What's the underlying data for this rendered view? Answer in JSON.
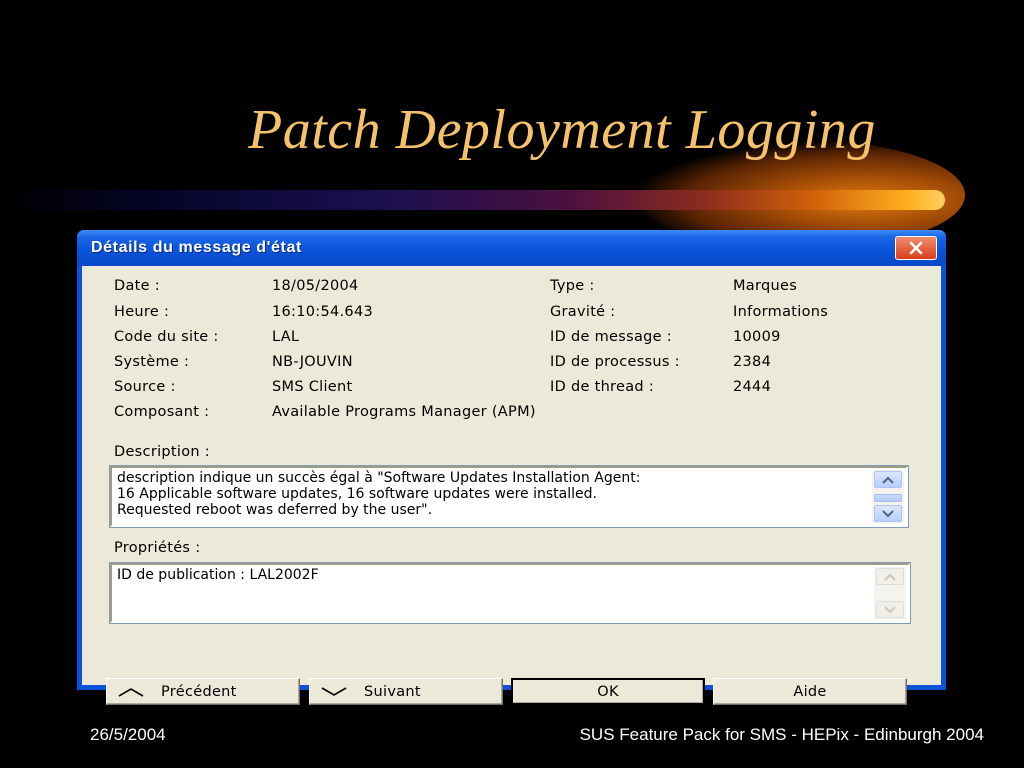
{
  "slide": {
    "title": "Patch Deployment Logging",
    "footer_date": "26/5/2004",
    "footer_text": "SUS Feature Pack for SMS - HEPix - Edinburgh 2004"
  },
  "dialog": {
    "title": "Détails du message d'état",
    "fields_left": [
      {
        "label": "Date :",
        "value": "18/05/2004"
      },
      {
        "label": "Heure :",
        "value": "16:10:54.643"
      },
      {
        "label": "Code du site :",
        "value": "LAL"
      },
      {
        "label": "Système :",
        "value": "NB-JOUVIN"
      },
      {
        "label": "Source :",
        "value": "SMS Client"
      },
      {
        "label": "Composant :",
        "value": "Available Programs Manager (APM)"
      }
    ],
    "fields_right": [
      {
        "label": "Type :",
        "value": "Marques"
      },
      {
        "label": "Gravité :",
        "value": "Informations"
      },
      {
        "label": "ID de message :",
        "value": "10009"
      },
      {
        "label": "ID de processus :",
        "value": "2384"
      },
      {
        "label": "ID de thread :",
        "value": "2444"
      }
    ],
    "description": {
      "label": "Description :",
      "lines": [
        "description indique un succès égal à \"Software Updates Installation Agent:",
        "16 Applicable software updates, 16 software updates were installed.",
        "Requested reboot was deferred by the user\"."
      ]
    },
    "properties": {
      "label": "Propriétés :",
      "lines": [
        "ID de publication : LAL2002F"
      ]
    },
    "buttons": {
      "prev": "Précédent",
      "next": "Suivant",
      "ok": "OK",
      "help": "Aide"
    }
  },
  "colors": {
    "title_gold": "#f5c26b",
    "titlebar_blue": "#0a52d8",
    "dialog_face": "#ece9d8"
  }
}
